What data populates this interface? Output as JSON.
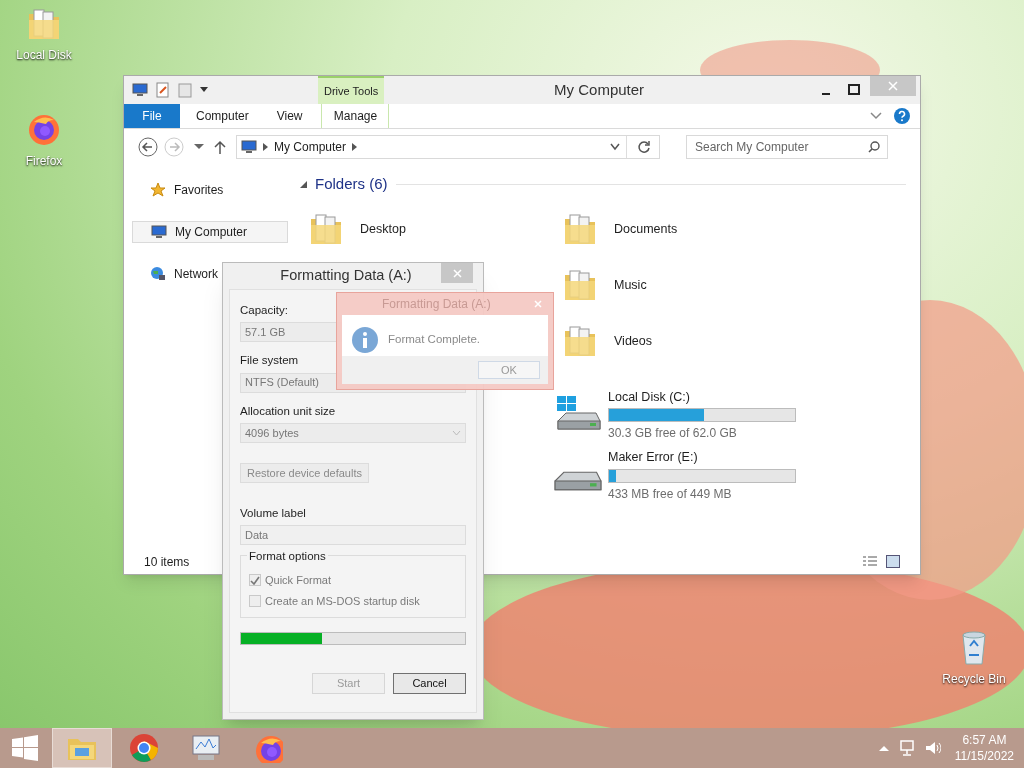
{
  "desktop_icons": [
    {
      "kind": "folder",
      "label": "Local Disk"
    },
    {
      "kind": "firefox",
      "label": "Firefox"
    },
    {
      "kind": "recycle",
      "label": "Recycle Bin"
    }
  ],
  "explorer": {
    "title": "My Computer",
    "context_tab_group": "Drive Tools",
    "ribbon_tabs": [
      {
        "label": "File",
        "kind": "file",
        "selected": false
      },
      {
        "label": "Computer",
        "kind": "tab",
        "selected": false
      },
      {
        "label": "View",
        "kind": "tab",
        "selected": false
      },
      {
        "label": "Manage",
        "kind": "context",
        "selected": false
      }
    ],
    "address": {
      "segment": "My Computer"
    },
    "search": {
      "placeholder": "Search My Computer"
    },
    "nav": [
      {
        "label": "Favorites",
        "kind": "star",
        "selected": false
      },
      {
        "label": "My Computer",
        "kind": "computer",
        "selected": true
      },
      {
        "label": "Network",
        "kind": "network",
        "selected": false
      }
    ],
    "folders": {
      "heading": "Folders (6)",
      "columns": [
        [
          {
            "name": "Desktop"
          }
        ],
        [
          {
            "name": "Documents"
          },
          {
            "name": "Music"
          },
          {
            "name": "Videos"
          }
        ]
      ]
    },
    "drives": [
      {
        "name": "Local Disk (C:)",
        "kind": "system",
        "level": 0.51,
        "reading": "30.3 GB free of 62.0 GB"
      },
      {
        "name": "Maker Error (E:)",
        "kind": "removable",
        "level": 0.036,
        "reading": "433 MB free of 449 MB"
      }
    ],
    "status": "10 items"
  },
  "format_dialog": {
    "title": "Formatting Data (A:)",
    "capacity": {
      "label": "Capacity:",
      "value": "57.1 GB"
    },
    "file_system": {
      "label": "File system",
      "value": "NTFS (Default)"
    },
    "allocation": {
      "label": "Allocation unit size",
      "value": "4096 bytes"
    },
    "restore_button": {
      "label": "Restore device defaults",
      "disabled": true
    },
    "volume_label": {
      "label": "Volume label",
      "value": "Data"
    },
    "options": {
      "heading": "Format options",
      "items": [
        {
          "label": "Quick Format",
          "checked": true
        },
        {
          "label": "Create an MS-DOS startup disk",
          "checked": false
        }
      ]
    },
    "progress": {
      "level": 0.36
    },
    "buttons": [
      {
        "label": "Start",
        "disabled": true
      },
      {
        "label": "Cancel",
        "disabled": false
      }
    ]
  },
  "message_box": {
    "title": "Formatting Data (A:)",
    "message": "Format Complete.",
    "button": "OK"
  },
  "taskbar": {
    "items": [
      {
        "kind": "explorer",
        "selected": true
      },
      {
        "kind": "chrome",
        "selected": false
      },
      {
        "kind": "monitor",
        "selected": false
      },
      {
        "kind": "firefox",
        "selected": false
      }
    ],
    "time": "6:57 AM",
    "date": "11/15/2022"
  }
}
